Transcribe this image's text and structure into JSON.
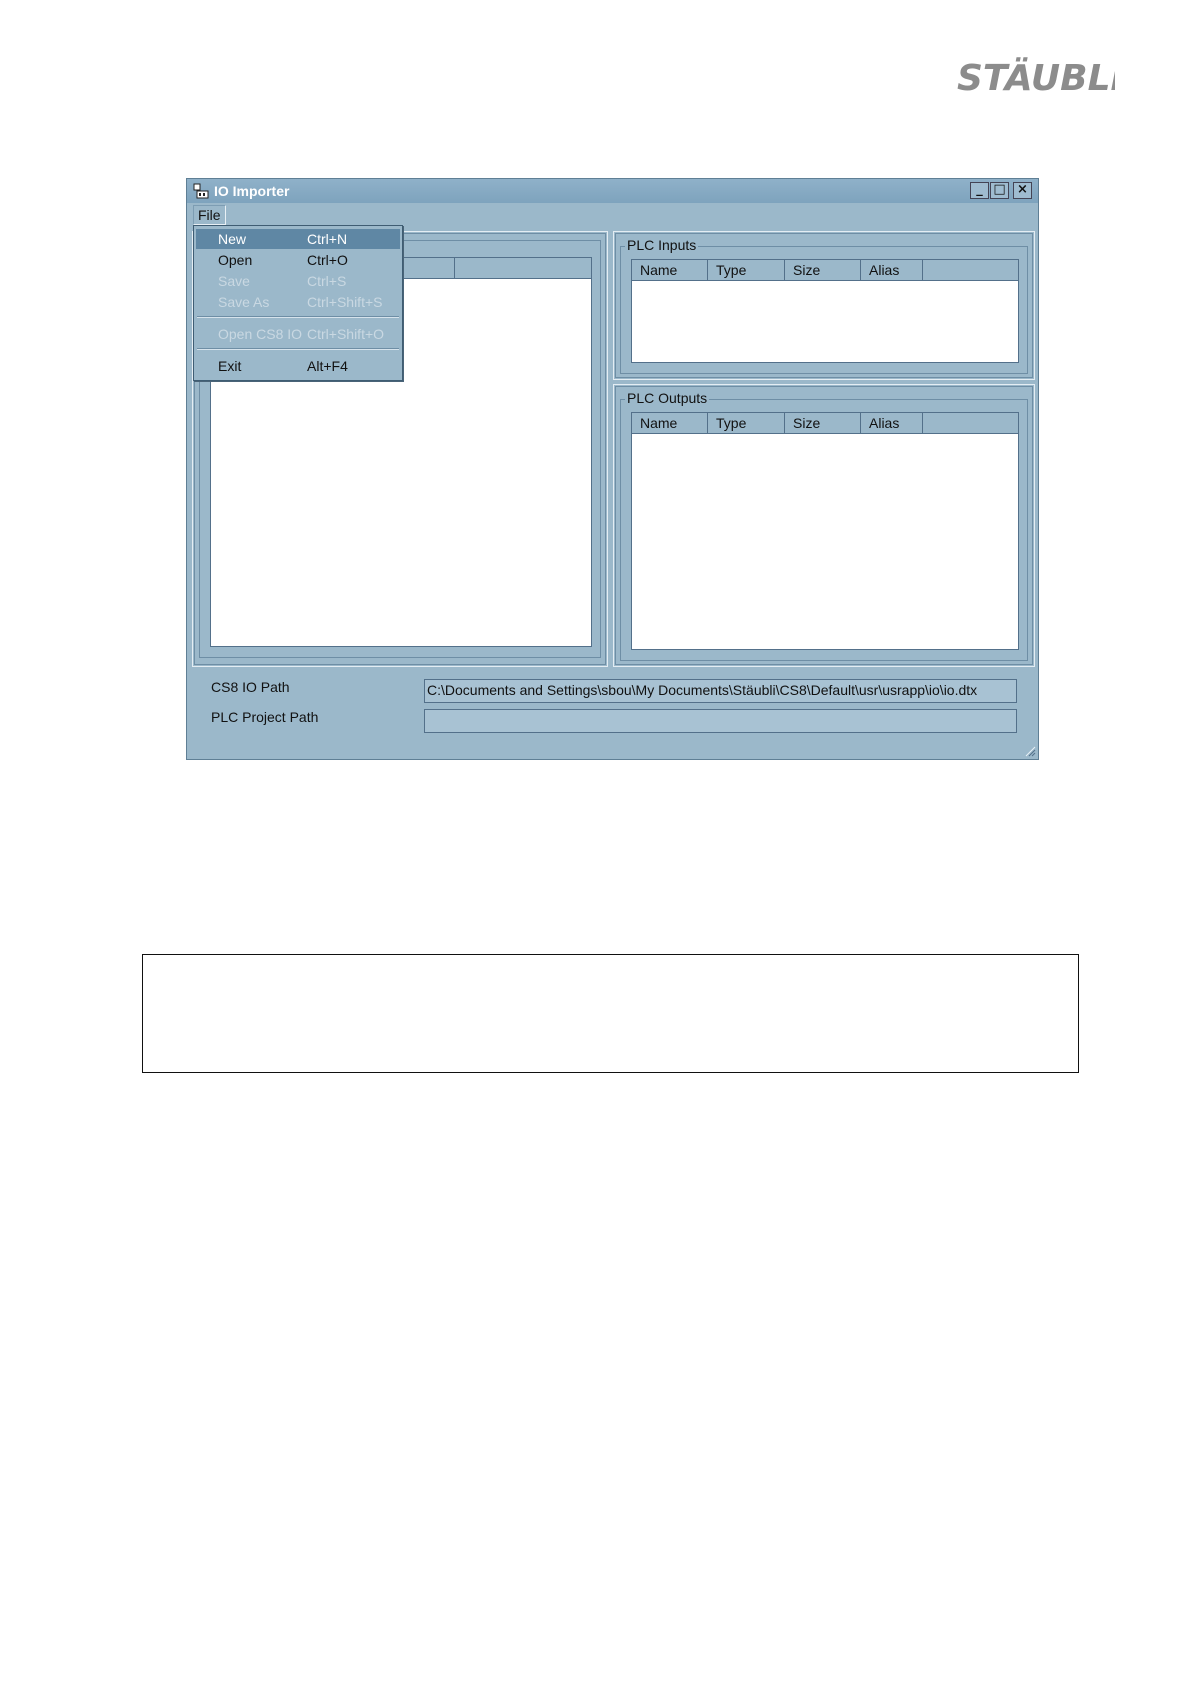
{
  "logo": {
    "text": "STÄUBLI"
  },
  "window": {
    "title": "IO Importer",
    "buttons": {
      "minimize": "_",
      "maximize": "□",
      "close": "×"
    }
  },
  "menubar": {
    "file": "File"
  },
  "file_menu": {
    "items": [
      {
        "label": "New",
        "shortcut": "Ctrl+N",
        "state": "selected"
      },
      {
        "label": "Open",
        "shortcut": "Ctrl+O",
        "state": "enabled"
      },
      {
        "label": "Save",
        "shortcut": "Ctrl+S",
        "state": "disabled"
      },
      {
        "label": "Save As",
        "shortcut": "Ctrl+Shift+S",
        "state": "disabled"
      },
      {
        "label": "Open CS8 IO",
        "shortcut": "Ctrl+Shift+O",
        "state": "disabled"
      },
      {
        "label": "Exit",
        "shortcut": "Alt+F4",
        "state": "enabled"
      }
    ]
  },
  "plc_inputs": {
    "label": "PLC Inputs",
    "columns": [
      "Name",
      "Type",
      "Size",
      "Alias"
    ]
  },
  "plc_outputs": {
    "label": "PLC Outputs",
    "columns": [
      "Name",
      "Type",
      "Size",
      "Alias"
    ]
  },
  "paths": {
    "cs8_label": "CS8 IO Path",
    "cs8_value": "C:\\Documents and Settings\\sbou\\My Documents\\Stäubli\\CS8\\Default\\usr\\usrapp\\io\\io.dtx",
    "plc_label": "PLC Project Path",
    "plc_value": ""
  }
}
